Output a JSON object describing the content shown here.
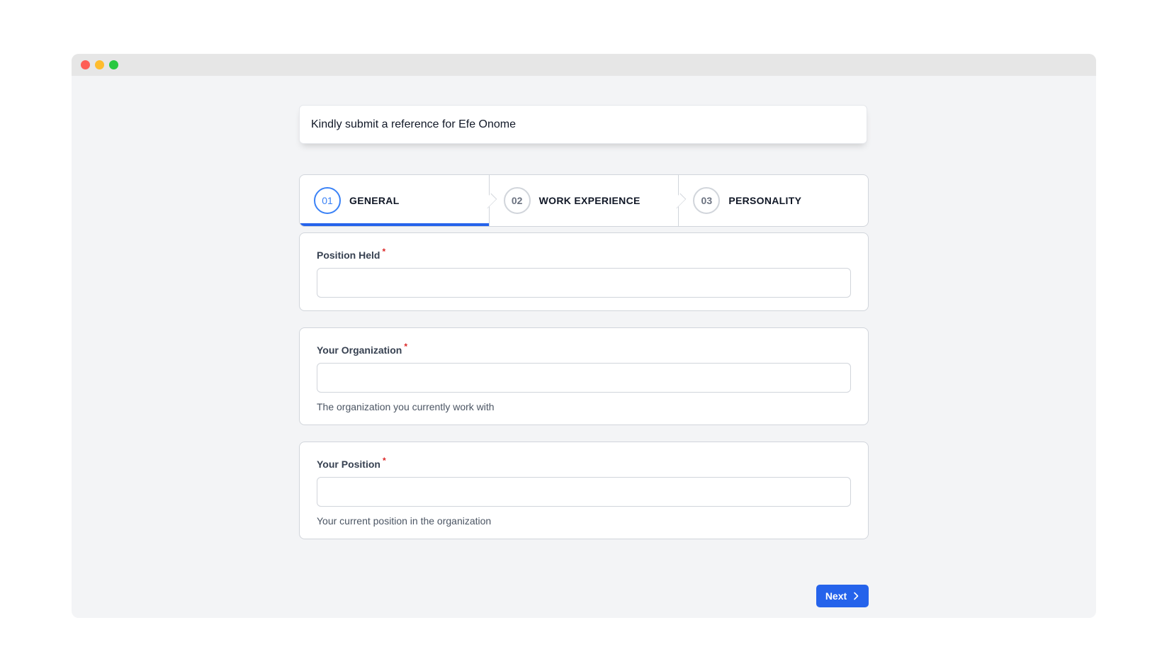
{
  "banner": {
    "text": "Kindly submit a reference for Efe Onome"
  },
  "steps": [
    {
      "number": "01",
      "label": "GENERAL",
      "active": true
    },
    {
      "number": "02",
      "label": "WORK EXPERIENCE",
      "active": false
    },
    {
      "number": "03",
      "label": "PERSONALITY",
      "active": false
    }
  ],
  "fields": [
    {
      "label": "Position Held",
      "required_mark": "*",
      "value": "",
      "help": ""
    },
    {
      "label": "Your Organization",
      "required_mark": "*",
      "value": "",
      "help": "The organization you currently work with"
    },
    {
      "label": "Your Position",
      "required_mark": "*",
      "value": "",
      "help": "Your current position in the organization"
    }
  ],
  "actions": {
    "next_label": "Next",
    "next_icon": "chevron-right-icon"
  },
  "colors": {
    "accent": "#2563eb",
    "required": "#dc2626",
    "window_bg": "#f3f4f6"
  }
}
